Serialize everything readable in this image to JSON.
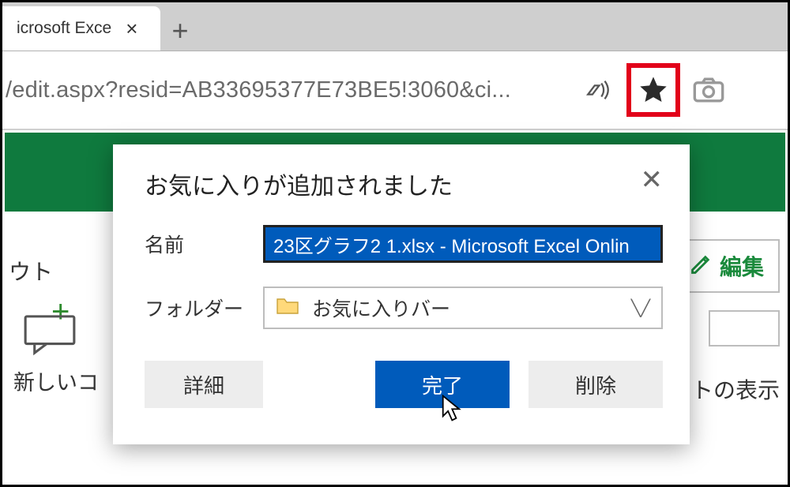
{
  "tab": {
    "title": "icrosoft Exce"
  },
  "address": {
    "url": "/edit.aspx?resid=AB33695377E73BE5!3060&ci..."
  },
  "popup": {
    "title": "お気に入りが追加されました",
    "name_label": "名前",
    "name_value": "23区グラフ2 1.xlsx - Microsoft Excel Onlin",
    "folder_label": "フォルダー",
    "folder_value": "お気に入りバー",
    "details_btn": "詳細",
    "done_btn": "完了",
    "delete_btn": "削除"
  },
  "background": {
    "left_text": "ウト",
    "new_comment": "新しいコ",
    "edit_label": "編集",
    "show_label": "トの表示"
  }
}
